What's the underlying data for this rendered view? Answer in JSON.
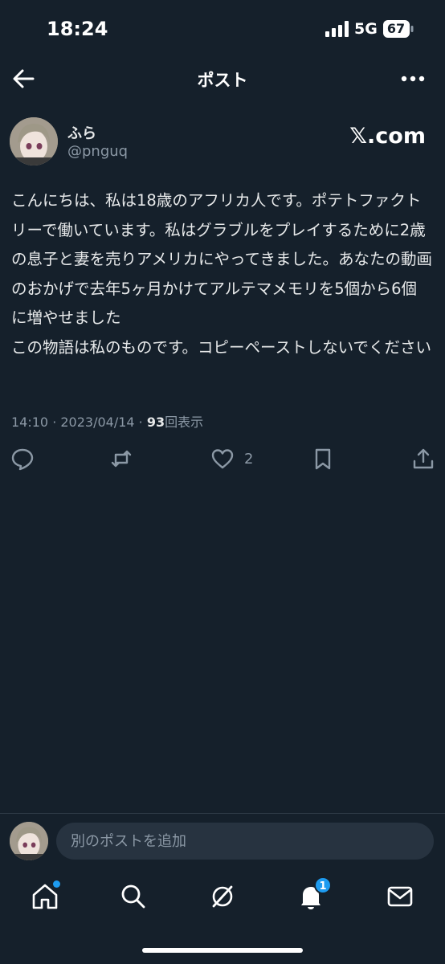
{
  "status_bar": {
    "time": "18:24",
    "network": "5G",
    "battery": "67"
  },
  "header": {
    "title": "ポスト"
  },
  "author": {
    "display_name": "ふら",
    "handle": "@pnguq"
  },
  "source_label": "𝕏.com",
  "post": {
    "text": "こんにちは、私は18歳のアフリカ人です。ポテトファクトリーで働いています。私はグラブルをプレイするために2歳の息子と妻を売りアメリカにやってきました。あなたの動画のおかげで去年5ヶ月かけてアルテマメモリを5個から6個に増やせました\nこの物語は私のものです。コピーペーストしないでください",
    "time": "14:10",
    "date": "2023/04/14",
    "views_count": "93",
    "views_label": "回表示",
    "likes": "2"
  },
  "reply": {
    "placeholder": "別のポストを追加"
  },
  "nav": {
    "notifications_badge": "1"
  },
  "colors": {
    "background": "#15202b",
    "accent": "#1d9bf0",
    "muted": "#8b98a5"
  }
}
